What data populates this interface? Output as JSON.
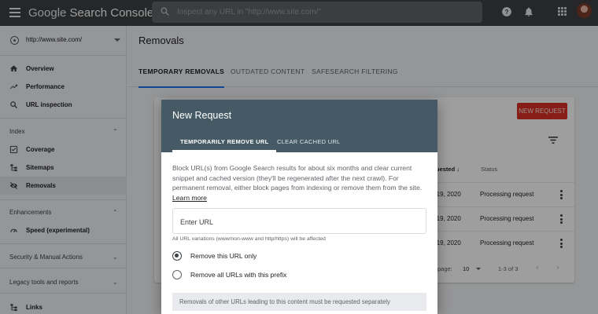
{
  "app": {
    "brand_google": "Google",
    "brand_product": "Search Console",
    "search_placeholder": "Inspect any URL in \"http://www.site.com/\""
  },
  "sidebar": {
    "property": "http://www.site.com/",
    "items_top": [
      {
        "label": "Overview",
        "icon": "home-icon"
      },
      {
        "label": "Performance",
        "icon": "trending-up-icon"
      },
      {
        "label": "URL inspection",
        "icon": "search-icon"
      }
    ],
    "index_section": "Index",
    "items_index": [
      {
        "label": "Coverage",
        "icon": "coverage-icon"
      },
      {
        "label": "Sitemaps",
        "icon": "sitemap-icon"
      },
      {
        "label": "Removals",
        "icon": "eye-off-icon",
        "active": true
      }
    ],
    "enhancements_section": "Enhancements",
    "items_enh": [
      {
        "label": "Speed (experimental)",
        "icon": "gauge-icon"
      }
    ],
    "security_section": "Security & Manual Actions",
    "legacy_section": "Legacy tools and reports",
    "links_label": "Links"
  },
  "main": {
    "title": "Removals",
    "tabs": [
      "TEMPORARY REMOVALS",
      "OUTDATED CONTENT",
      "SAFESEARCH FILTERING"
    ],
    "new_request_label": "NEW REQUEST",
    "table_headers": {
      "requested": "uested",
      "status": "Status"
    },
    "rows": [
      {
        "date": "n 19, 2020",
        "status": "Processing request"
      },
      {
        "date": "n 19, 2020",
        "status": "Processing request"
      },
      {
        "date": "n 19, 2020",
        "status": "Processing request"
      }
    ],
    "pager": {
      "rows_label": "page:",
      "rows_value": "10",
      "range": "1-3 of 3"
    }
  },
  "modal": {
    "title": "New Request",
    "tabs": [
      "TEMPORARILY REMOVE URL",
      "CLEAR CACHED URL"
    ],
    "description": "Block URL(s) from Google Search results for about six months and clear current snippet and cached version (they'll be regenerated after the next crawl). For permanent removal, either block pages from indexing or remove them from the site.",
    "learn_more": "Learn more",
    "url_placeholder": "Enter URL",
    "hint": "All URL variations (www/non-www and http/https) will be affected",
    "option_1": "Remove this URL only",
    "option_2": "Remove all URLs with this prefix",
    "notice": "Removals of other URLs leading to this content must be requested separately"
  },
  "colors": {
    "topbar": "#3c4043",
    "modal_header": "#455a64",
    "accent_red": "#d93025",
    "tab_indicator": "#1a73e8"
  }
}
